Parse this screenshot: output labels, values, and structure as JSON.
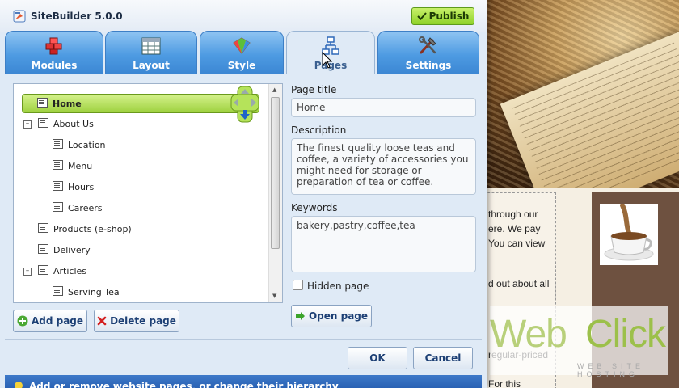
{
  "app": {
    "title": "SiteBuilder 5.0.0",
    "publish_label": "Publish"
  },
  "tabs": [
    {
      "label": "Modules",
      "icon": "modules-icon",
      "active": false
    },
    {
      "label": "Layout",
      "icon": "layout-icon",
      "active": false
    },
    {
      "label": "Style",
      "icon": "style-icon",
      "active": false
    },
    {
      "label": "Pages",
      "icon": "pages-icon",
      "active": true
    },
    {
      "label": "Settings",
      "icon": "settings-icon",
      "active": false
    }
  ],
  "tree": {
    "items": [
      {
        "label": "Home",
        "selected": true
      },
      {
        "label": "About Us",
        "expanded": true
      },
      {
        "label": "Location"
      },
      {
        "label": "Menu"
      },
      {
        "label": "Hours"
      },
      {
        "label": "Careers"
      },
      {
        "label": "Products (e-shop)"
      },
      {
        "label": "Delivery"
      },
      {
        "label": "Articles",
        "expanded": true
      },
      {
        "label": "Serving Tea"
      }
    ]
  },
  "buttons": {
    "add_page": "Add page",
    "delete_page": "Delete page",
    "open_page": "Open page",
    "ok": "OK",
    "cancel": "Cancel"
  },
  "form": {
    "page_title_label": "Page title",
    "page_title_value": "Home",
    "description_label": "Description",
    "description_value": "The finest quality loose teas and coffee, a variety of accessories you might need for storage or preparation of tea or coffee.",
    "keywords_label": "Keywords",
    "keywords_value": "bakery,pastry,coffee,tea",
    "hidden_page_label": "Hidden page",
    "hidden_page_checked": false
  },
  "status": {
    "text": "Add or remove website pages, or change their hierarchy"
  },
  "background_site": {
    "text_lines": [
      "through our",
      "ere. We pay",
      "You can view",
      "d out about all",
      "regular-priced",
      "For this"
    ],
    "logo_word_1": "Web",
    "logo_word_2": "Click",
    "logo_tagline": "WEB SITE HOSTING"
  },
  "colors": {
    "tab_blue": "#4e9be2",
    "publish_green": "#8fd229",
    "selected_row_green": "#9ed13f",
    "status_bar_blue": "#2a62b4"
  }
}
